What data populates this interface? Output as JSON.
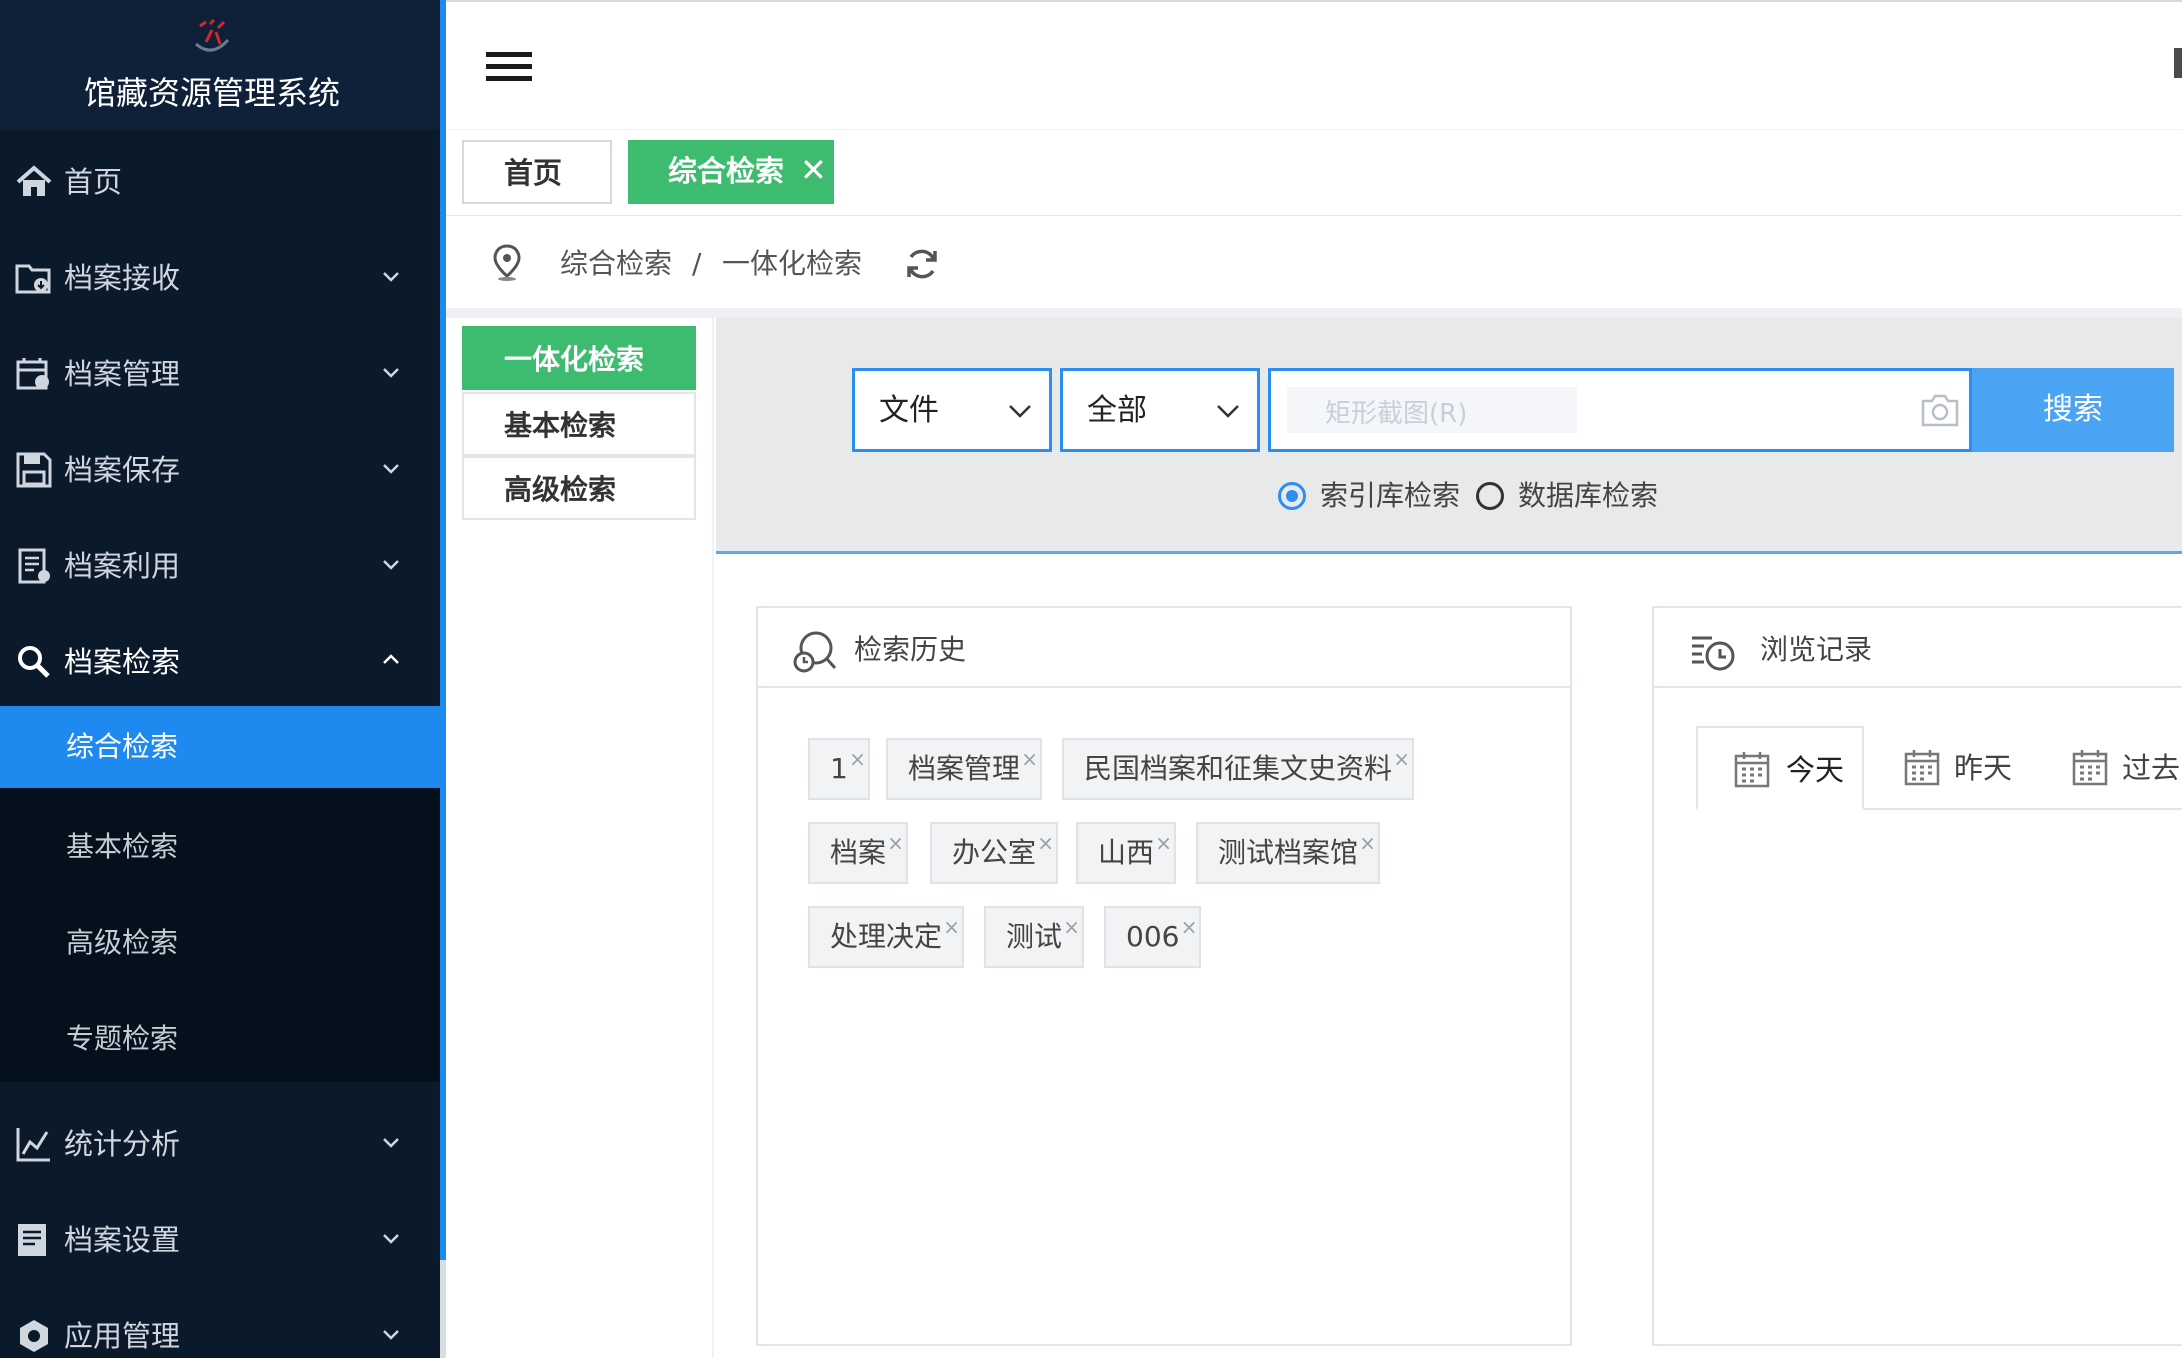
{
  "app": {
    "title": "馆藏资源管理系统"
  },
  "sidebar": {
    "items": [
      {
        "label": "首页",
        "icon": "home-icon"
      },
      {
        "label": "档案接收",
        "icon": "folder-receive-icon"
      },
      {
        "label": "档案管理",
        "icon": "archive-manage-icon"
      },
      {
        "label": "档案保存",
        "icon": "save-icon"
      },
      {
        "label": "档案利用",
        "icon": "archive-use-icon"
      },
      {
        "label": "档案检索",
        "icon": "search-icon"
      },
      {
        "label": "统计分析",
        "icon": "chart-icon"
      },
      {
        "label": "档案设置",
        "icon": "settings-doc-icon"
      },
      {
        "label": "应用管理",
        "icon": "app-manage-icon"
      }
    ],
    "subitems": [
      {
        "label": "综合检索",
        "active": true
      },
      {
        "label": "基本检索"
      },
      {
        "label": "高级检索"
      },
      {
        "label": "专题检索"
      }
    ]
  },
  "tabs": {
    "home": "首页",
    "active": "综合检索",
    "close": "✕"
  },
  "breadcrumb": {
    "level1": "综合检索",
    "sep": "/",
    "level2": "一体化检索"
  },
  "search_types": [
    "一体化检索",
    "基本检索",
    "高级检索"
  ],
  "search": {
    "category": "文件",
    "scope": "全部",
    "placeholder": "矩形截图(R)",
    "button": "搜索",
    "mode_index": "索引库检索",
    "mode_db": "数据库检索",
    "selected_mode": "索引库检索"
  },
  "history": {
    "title": "检索历史",
    "chips": [
      "1",
      "档案管理",
      "民国档案和征集文史资料",
      "档案",
      "办公室",
      "山西",
      "测试档案馆",
      "处理决定",
      "测试",
      "006"
    ],
    "close_glyph": "×"
  },
  "browse": {
    "title": "浏览记录",
    "tabs": [
      "今天",
      "昨天",
      "过去"
    ]
  },
  "colors": {
    "sidebar": "#0b1a2b",
    "accent_blue": "#1e8af0",
    "accent_green": "#3dbb6e",
    "button_blue": "#4aa3f3"
  }
}
